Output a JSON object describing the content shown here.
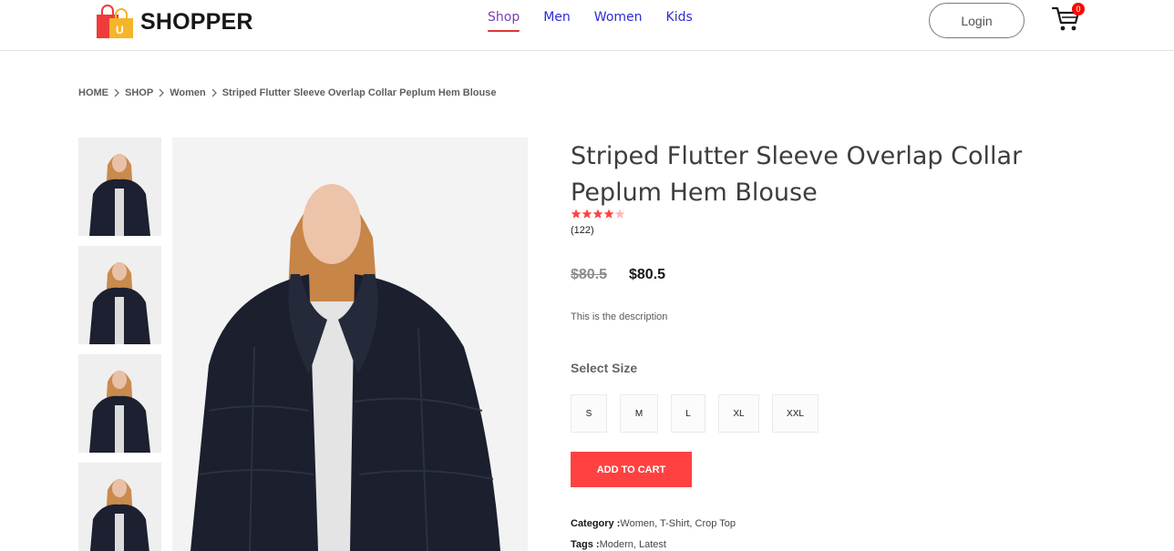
{
  "brand": {
    "name": "SHOPPER",
    "logo_icon": "shopping-bags-icon"
  },
  "nav": {
    "items": [
      {
        "label": "Shop",
        "active": true
      },
      {
        "label": "Men",
        "active": false
      },
      {
        "label": "Women",
        "active": false
      },
      {
        "label": "Kids",
        "active": false
      }
    ],
    "login_label": "Login",
    "cart_icon": "cart-icon",
    "cart_count": "0"
  },
  "breadcrumb": [
    "HOME",
    "SHOP",
    "Women",
    "Striped Flutter Sleeve Overlap Collar Peplum Hem Blouse"
  ],
  "product": {
    "title": "Striped Flutter Sleeve Overlap Collar Peplum Hem Blouse",
    "rating": 4,
    "rating_max": 5,
    "reviews": "(122)",
    "old_price": "$80.5",
    "new_price": "$80.5",
    "description": "This is the description",
    "size_label": "Select Size",
    "sizes": [
      "S",
      "M",
      "L",
      "XL",
      "XXL"
    ],
    "add_to_cart": "ADD TO CART",
    "category_label": "Category :",
    "category_value": "Women, T-Shirt, Crop Top",
    "tags_label": "Tags :",
    "tags_value": "Modern, Latest"
  },
  "colors": {
    "accent": "#ff4141",
    "nav_link": "#2b2bd6",
    "star": "#ff4141",
    "badge": "#ff0000"
  }
}
